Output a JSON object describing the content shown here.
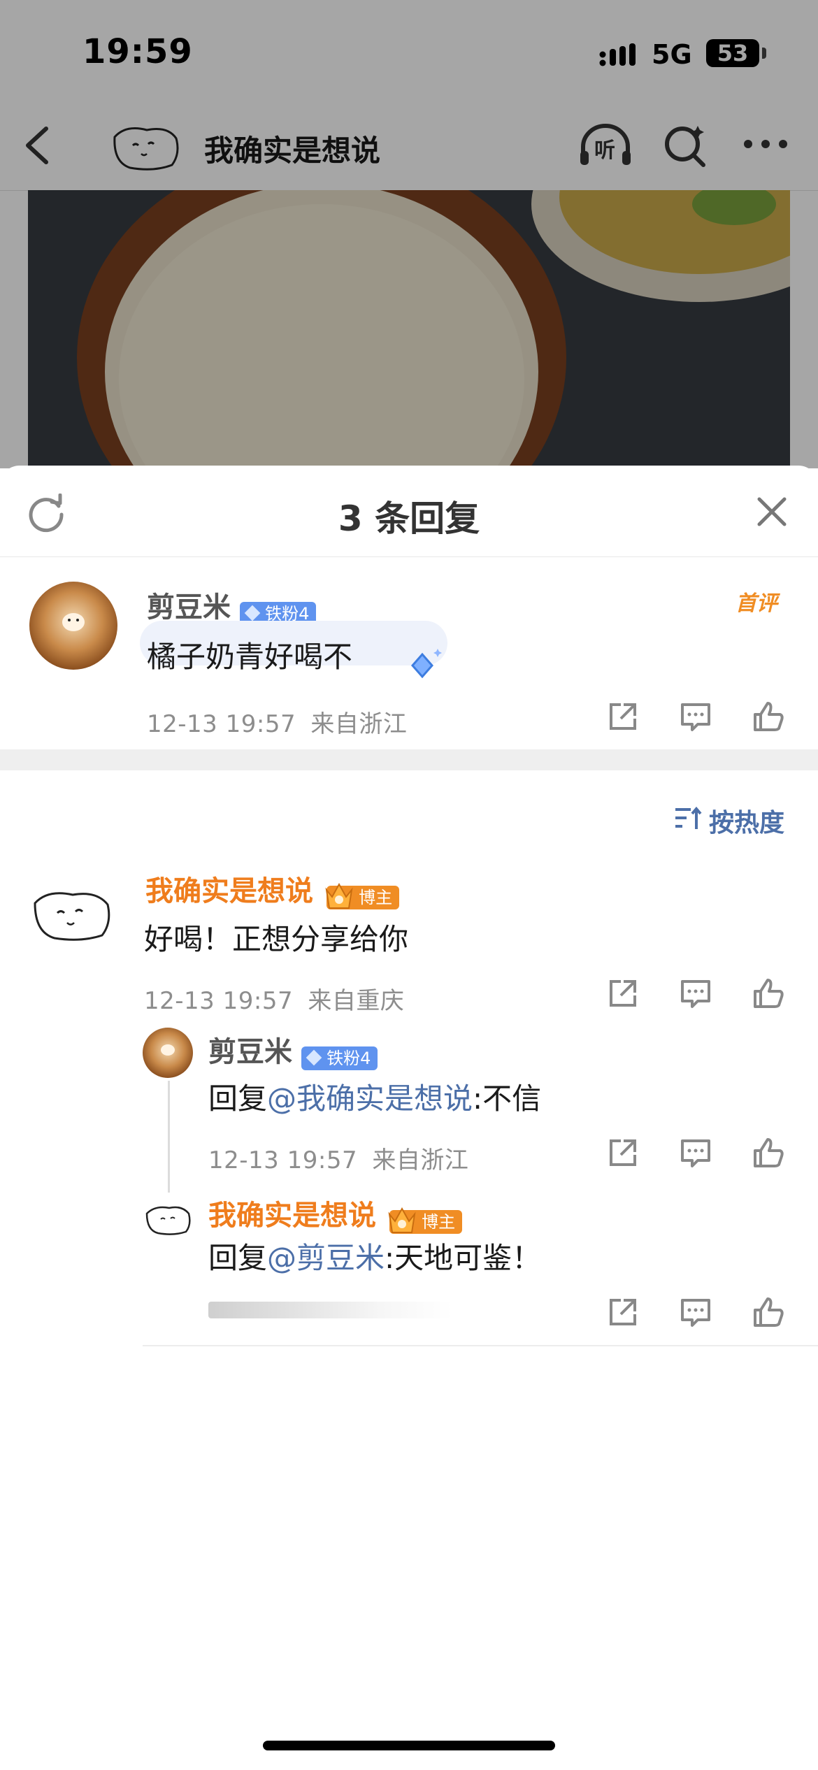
{
  "status_bar": {
    "time": "19:59",
    "network": "5G",
    "battery": "53"
  },
  "nav": {
    "title": "我确实是想说",
    "listen_label": "听"
  },
  "sheet": {
    "title": "3 条回复",
    "main_comment": {
      "author": "剪豆米",
      "badge": "铁粉4",
      "first_review_tag": "首评",
      "text": "橘子奶青好喝不",
      "time": "12-13 19:57",
      "location": "来自浙江"
    },
    "sort_label": "按热度",
    "replies": [
      {
        "author": "我确实是想说",
        "badge": "博主",
        "text": "好喝！正想分享给你",
        "time": "12-13 19:57",
        "location": "来自重庆"
      },
      {
        "author": "剪豆米",
        "badge": "铁粉4",
        "reply_prefix": "回复",
        "mention": "@我确实是想说",
        "text": ":不信",
        "time": "12-13 19:57",
        "location": "来自浙江"
      },
      {
        "author": "我确实是想说",
        "badge": "博主",
        "reply_prefix": "回复",
        "mention": "@剪豆米",
        "text": ":天地可鉴！"
      }
    ]
  },
  "colors": {
    "owner_orange": "#ef7d1d",
    "mention_blue": "#4c6fa8",
    "fan_badge": "#5f93ef",
    "owner_badge": "#f08d24"
  },
  "icons": [
    "back-icon",
    "headphones-icon",
    "search-icon",
    "more-icon",
    "refresh-icon",
    "close-icon",
    "share-icon",
    "comment-icon",
    "like-icon",
    "sort-icon"
  ]
}
